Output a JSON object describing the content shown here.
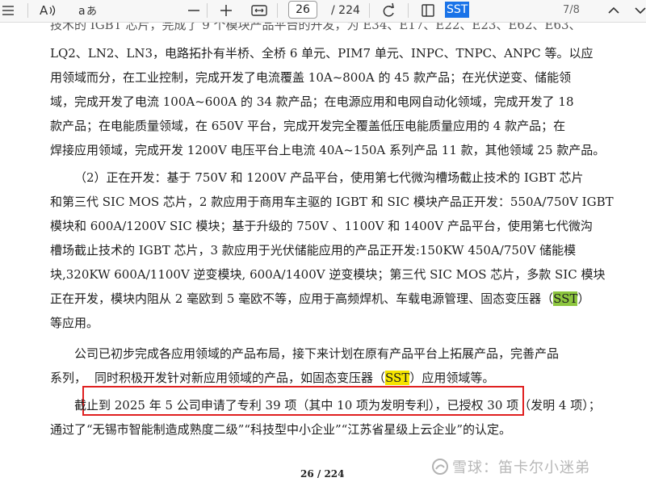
{
  "toolbar": {
    "page_current": "26",
    "page_total": "/ 224",
    "icons": [
      "list-icon",
      "read-aloud-icon",
      "translate-icon",
      "zoom-out-icon",
      "zoom-in-icon",
      "fit-page-icon",
      "rotate-icon",
      "page-view-icon"
    ]
  },
  "find": {
    "query": "SST",
    "count": "7/8"
  },
  "document": {
    "cut_top_line": "技术的 IGBT 芯片，完成了 9 个模块产品平台的开发，为 E34、E17、E22、E23、E62、E63、",
    "para1": [
      "LQ2、LN2、LN3，电路拓扑有半桥、全桥 6 单元、PIM7 单元、INPC、TNPC、ANPC 等。以应",
      "用领域而分，在工业控制，完成开发了电流覆盖 10A~800A 的 45 款产品；在光伏逆变、储能领",
      "域，完成开发了电流 100A~600A 的 34 款产品；在电源应用和电网自动化领域，完成开发了 18",
      "款产品；在电能质量领域，在 650V 平台，完成开发完全覆盖低压电能质量应用的 4 款产品；在",
      "焊接应用领域，完成开发 1200V 电压平台上电流 40A~150A 系列产品 11 款，其他领域 25 款产品。"
    ],
    "para2": [
      "（2）正在开发：基于 750V 和 1200V 产品平台，使用第七代微沟槽场截止技术的 IGBT 芯片",
      "和第三代 SIC MOS 芯片，2 款应用于商用车主驱的 IGBT 和 SIC 模块产品正开发：550A/750V IGBT",
      "模块和 600A/1200V SIC 模块；基于升级的 750V 、1100V 和 1400V 产品平台，使用第七代微沟",
      "槽场截止技术的 IGBT 芯片，3 款应用于光伏储能应用的产品正开发:150KW 450A/750V 储能模",
      "块,320KW 600A/1100V 逆变模块, 600A/1400V 逆变模块；第三代 SIC MOS 芯片，多款 SIC 模块"
    ],
    "para2_line6_before": "正在开发，模块内阻从 2 毫欧到 5 毫欧不等，应用于高频焊机、车载电源管理、固态变压器（",
    "para2_line6_hl": "SST",
    "para2_line6_after": "）",
    "para2_line7": "等应用。",
    "para3_line1": "公司已初步完成各应用领域的产品布局，接下来计划在原有产品平台上拓展产品，完善产品",
    "para3_line2_a": "系列，",
    "para3_line2_b": "同时积极开发针对新应用领域的产品，如固态变压器（",
    "para3_line2_hl": "SST",
    "para3_line2_c": "）应用领域等。",
    "para4_line1": "截止到 2025 年 5 公司申请了专利 39 项（其中 10 项为发明专利），已授权 30 项（发明 4 项）；",
    "para4_line2": "通过了“无锡市智能制造成熟度二级”“科技型中小企业”“江苏省星级上云企业”的认定。",
    "page_number": "26 / 224"
  },
  "watermark": {
    "text": "雪球：笛卡尔小迷弟"
  }
}
